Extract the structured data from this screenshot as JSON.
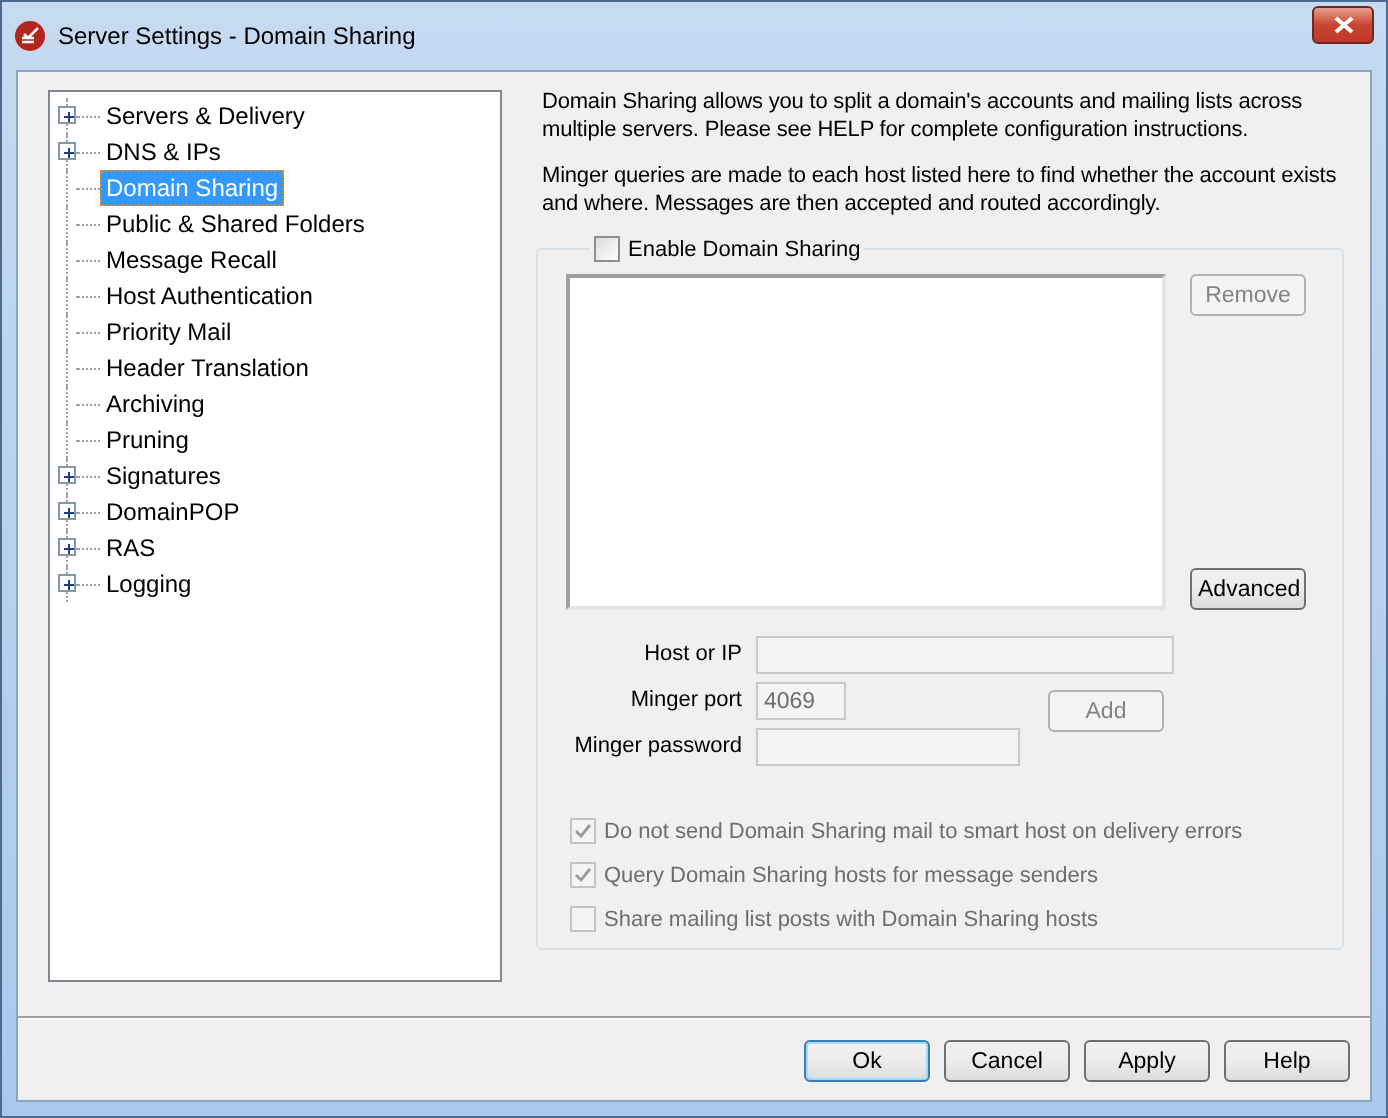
{
  "window": {
    "title": "Server Settings - Domain Sharing"
  },
  "tree": [
    {
      "label": "Servers & Delivery",
      "kind": "branch",
      "expanded": false,
      "selected": false
    },
    {
      "label": "DNS & IPs",
      "kind": "branch",
      "expanded": false,
      "selected": false
    },
    {
      "label": "Domain Sharing",
      "kind": "leaf",
      "selected": true
    },
    {
      "label": "Public & Shared Folders",
      "kind": "leaf",
      "selected": false
    },
    {
      "label": "Message Recall",
      "kind": "leaf",
      "selected": false
    },
    {
      "label": "Host Authentication",
      "kind": "leaf",
      "selected": false
    },
    {
      "label": "Priority Mail",
      "kind": "leaf",
      "selected": false
    },
    {
      "label": "Header Translation",
      "kind": "leaf",
      "selected": false
    },
    {
      "label": "Archiving",
      "kind": "leaf",
      "selected": false
    },
    {
      "label": "Pruning",
      "kind": "leaf",
      "selected": false
    },
    {
      "label": "Signatures",
      "kind": "branch",
      "expanded": false,
      "selected": false
    },
    {
      "label": "DomainPOP",
      "kind": "branch",
      "expanded": false,
      "selected": false
    },
    {
      "label": "RAS",
      "kind": "branch",
      "expanded": false,
      "selected": false
    },
    {
      "label": "Logging",
      "kind": "branch",
      "expanded": false,
      "selected": false
    }
  ],
  "description": [
    "Domain Sharing allows you to split a domain's accounts and mailing lists across multiple servers.  Please see HELP for complete configuration instructions.",
    "Minger queries are made to each host listed here to find whether the account exists and where. Messages are then accepted and routed accordingly."
  ],
  "group": {
    "label": "Enable Domain Sharing",
    "checked": false,
    "list_buttons": [
      {
        "label": "Remove",
        "disabled": true
      },
      {
        "label": "Advanced",
        "disabled": false
      }
    ],
    "fields": [
      {
        "label": "Host or IP",
        "disabled": true
      },
      {
        "label": "Minger port",
        "value": "4069",
        "disabled": true
      },
      {
        "label": "Minger password",
        "disabled": true
      }
    ],
    "add_button": {
      "label": "Add",
      "disabled": true
    },
    "options": [
      {
        "label": "Do not send Domain Sharing mail to smart host on delivery errors",
        "checked": true,
        "disabled": true
      },
      {
        "label": "Query Domain Sharing hosts for message senders",
        "checked": true,
        "disabled": true
      },
      {
        "label": "Share mailing list posts with Domain Sharing hosts",
        "checked": false,
        "disabled": true
      }
    ]
  },
  "buttons": [
    {
      "label": "Ok",
      "default": true
    },
    {
      "label": "Cancel",
      "default": false
    },
    {
      "label": "Apply",
      "default": false
    },
    {
      "label": "Help",
      "default": false
    }
  ]
}
